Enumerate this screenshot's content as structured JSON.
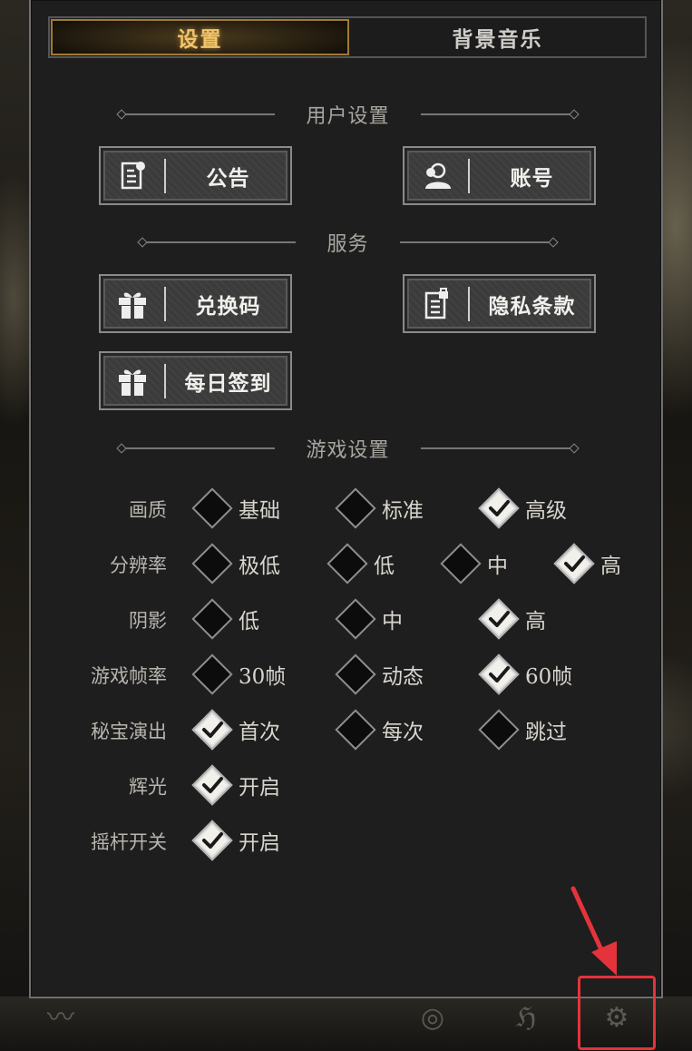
{
  "tabs": [
    {
      "label": "设置",
      "active": true
    },
    {
      "label": "背景音乐",
      "active": false
    }
  ],
  "sections": {
    "user": "用户设置",
    "service": "服务",
    "game": "游戏设置"
  },
  "buttons": {
    "announcement": {
      "label": "公告",
      "icon": "document-icon"
    },
    "account": {
      "label": "账号",
      "icon": "user-icon"
    },
    "redeem": {
      "label": "兑换码",
      "icon": "gift-icon"
    },
    "privacy": {
      "label": "隐私条款",
      "icon": "document-lock-icon"
    },
    "checkin": {
      "label": "每日签到",
      "icon": "gift-icon"
    }
  },
  "settings": {
    "quality": {
      "label": "画质",
      "options": [
        "基础",
        "标准",
        "高级"
      ],
      "selected": "高级"
    },
    "resolution": {
      "label": "分辨率",
      "options": [
        "极低",
        "低",
        "中",
        "高"
      ],
      "selected": "高"
    },
    "shadow": {
      "label": "阴影",
      "options": [
        "低",
        "中",
        "高"
      ],
      "selected": "高"
    },
    "framerate": {
      "label": "游戏帧率",
      "options": [
        "30帧",
        "动态",
        "60帧"
      ],
      "selected": "60帧"
    },
    "treasure": {
      "label": "秘宝演出",
      "options": [
        "首次",
        "每次",
        "跳过"
      ],
      "selected": "首次"
    },
    "glow": {
      "label": "辉光",
      "options": [
        "开启"
      ],
      "selected": "开启"
    },
    "joystick": {
      "label": "摇杆开关",
      "options": [
        "开启"
      ],
      "selected": "开启"
    }
  },
  "colors": {
    "active_tab_text": "#f2c46b",
    "annotation": "#e5333b",
    "panel_bg": "#1e1e1e"
  }
}
